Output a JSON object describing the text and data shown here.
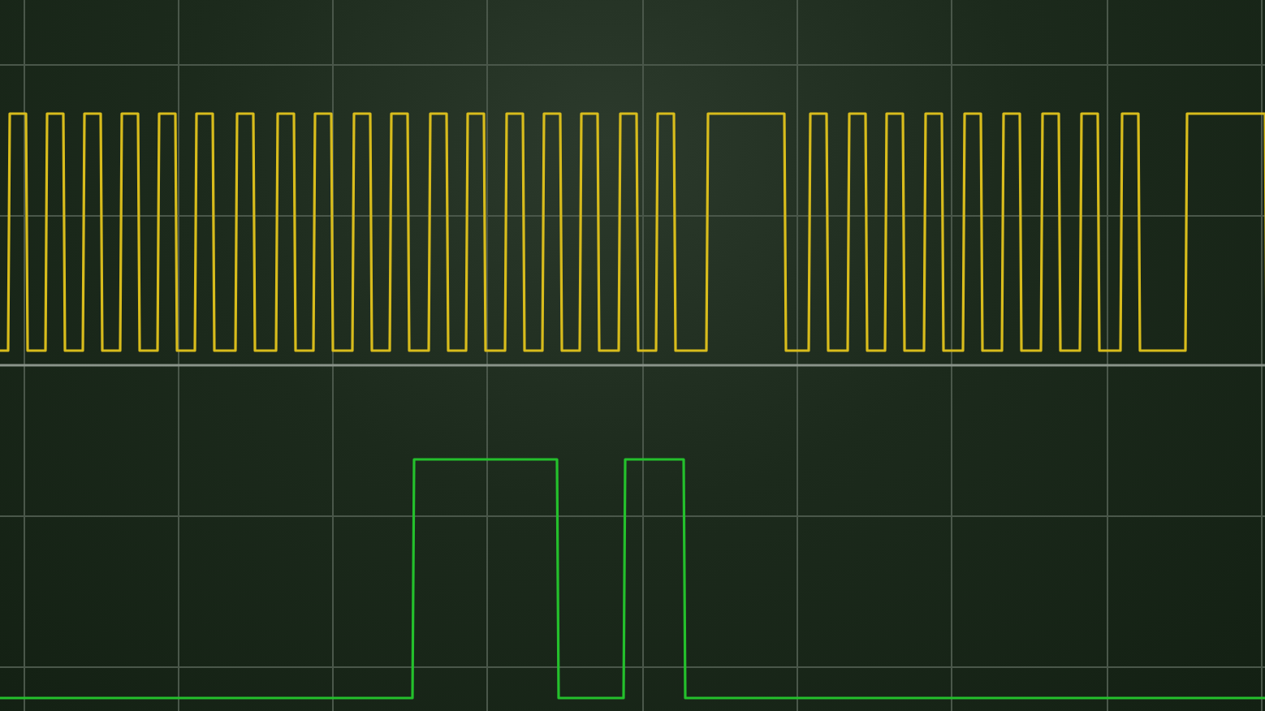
{
  "traces": [
    {
      "color": "#d8bc1c"
    },
    {
      "color": "#24c02c"
    }
  ]
}
